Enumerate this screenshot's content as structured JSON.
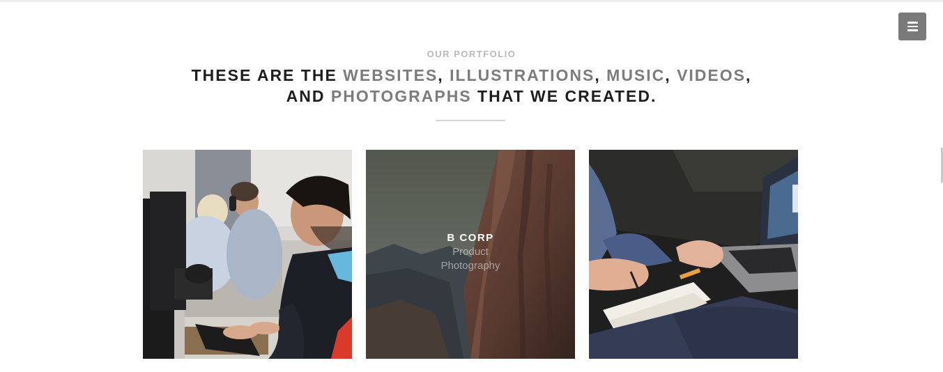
{
  "header": {
    "menu_icon": "hamburger-menu-icon"
  },
  "portfolio": {
    "eyebrow": "OUR PORTFOLIO",
    "headline": {
      "line1": {
        "part1": "THESE ARE THE ",
        "hl1": "WEBSITES",
        "sep1": ", ",
        "hl2": "ILLUSTRATIONS",
        "sep2": ", ",
        "hl3": "MUSIC",
        "sep3": ", ",
        "hl4": "VIDEOS",
        "end": ","
      },
      "line2": {
        "part1": "AND ",
        "hl1": "PHOTOGRAPHS",
        "part2": " THAT WE CREATED."
      }
    },
    "items": [
      {
        "image": "man-typing-at-computer-office-photo"
      },
      {
        "image": "rocky-cliff-mountains-photo",
        "title": "B CORP",
        "subtitle": "Product Photography"
      },
      {
        "image": "hands-laptop-notebook-photo"
      }
    ]
  },
  "colors": {
    "heading": "#1e1e1e",
    "highlight": "#7c7c7c",
    "eyebrow": "#b9b9b9",
    "menu_button": "#7a7a7a"
  }
}
